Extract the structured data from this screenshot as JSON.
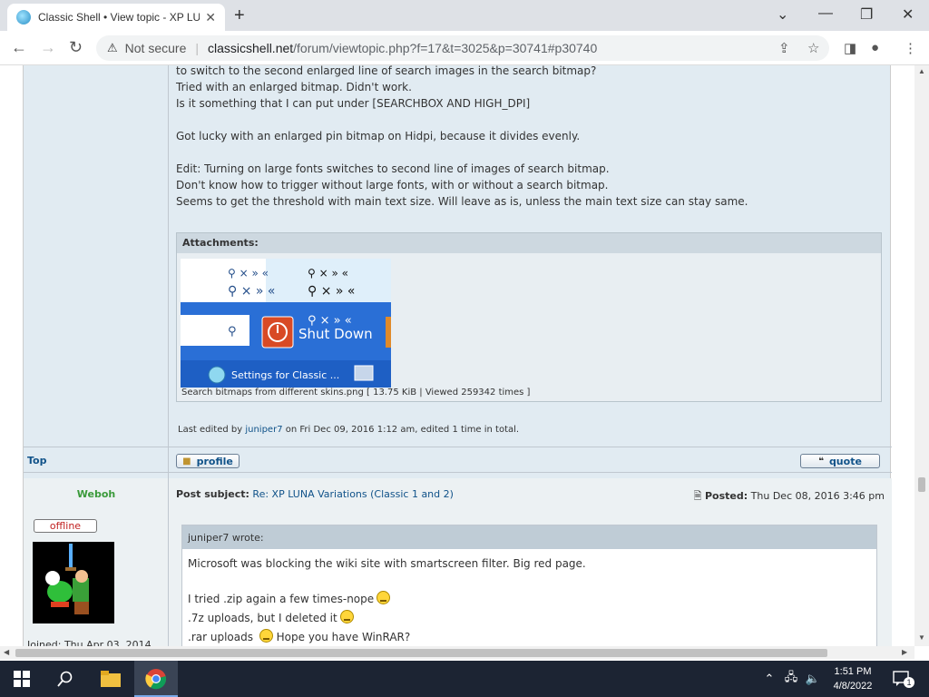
{
  "browser": {
    "tab_title": "Classic Shell • View topic - XP LUNA",
    "not_secure": "Not secure",
    "url_host": "classicshell.net",
    "url_path": "/forum/viewtopic.php?f=17&t=3025&p=30741#p30740"
  },
  "post1": {
    "lines": [
      "to switch to the second enlarged line of search images in the search bitmap?",
      "Tried with an enlarged bitmap. Didn't work.",
      "Is it something that I can put under [SEARCHBOX AND HIGH_DPI]",
      "",
      "Got lucky with an enlarged pin bitmap on Hidpi, because it divides evenly.",
      "",
      "Edit: Turning on large fonts switches to second line of images of search bitmap.",
      "Don't know how to trigger without large fonts, with or without a search bitmap.",
      "Seems to get the threshold with main text size. Will leave as is, unless the main text size can stay same."
    ],
    "attachments_label": "Attachments:",
    "attachment_image": {
      "shutdown_label": "Shut Down",
      "settings_label": "Settings for Classic ..."
    },
    "attachment_caption": "Search bitmaps from different skins.png [ 13.75 KiB | Viewed 259342 times ]",
    "edited_prefix": "Last edited by ",
    "edited_user": "juniper7",
    "edited_suffix": " on Fri Dec 09, 2016 1:12 am, edited 1 time in total.",
    "top_link": "Top",
    "profile_label": "profile",
    "quote_label": "quote"
  },
  "post2": {
    "author": "Weboh",
    "status": "offline",
    "joined": "Joined: Thu Apr 03, 2014",
    "subject_label": "Post subject:",
    "subject_link": "Re: XP LUNA Variations (Classic 1 and 2)",
    "posted_label": "Posted:",
    "posted_date": "Thu Dec 08, 2016 3:46 pm",
    "quote_author": "juniper7 wrote:",
    "quote_lines": [
      "Microsoft was blocking the wiki site with smartscreen filter. Big red page.",
      "I tried .zip again a few times-nope",
      ".7z uploads, but I deleted it",
      ".rar uploads",
      "Hope you have WinRAR?"
    ]
  },
  "taskbar": {
    "time": "1:51 PM",
    "date": "4/8/2022",
    "notifications": "1"
  }
}
